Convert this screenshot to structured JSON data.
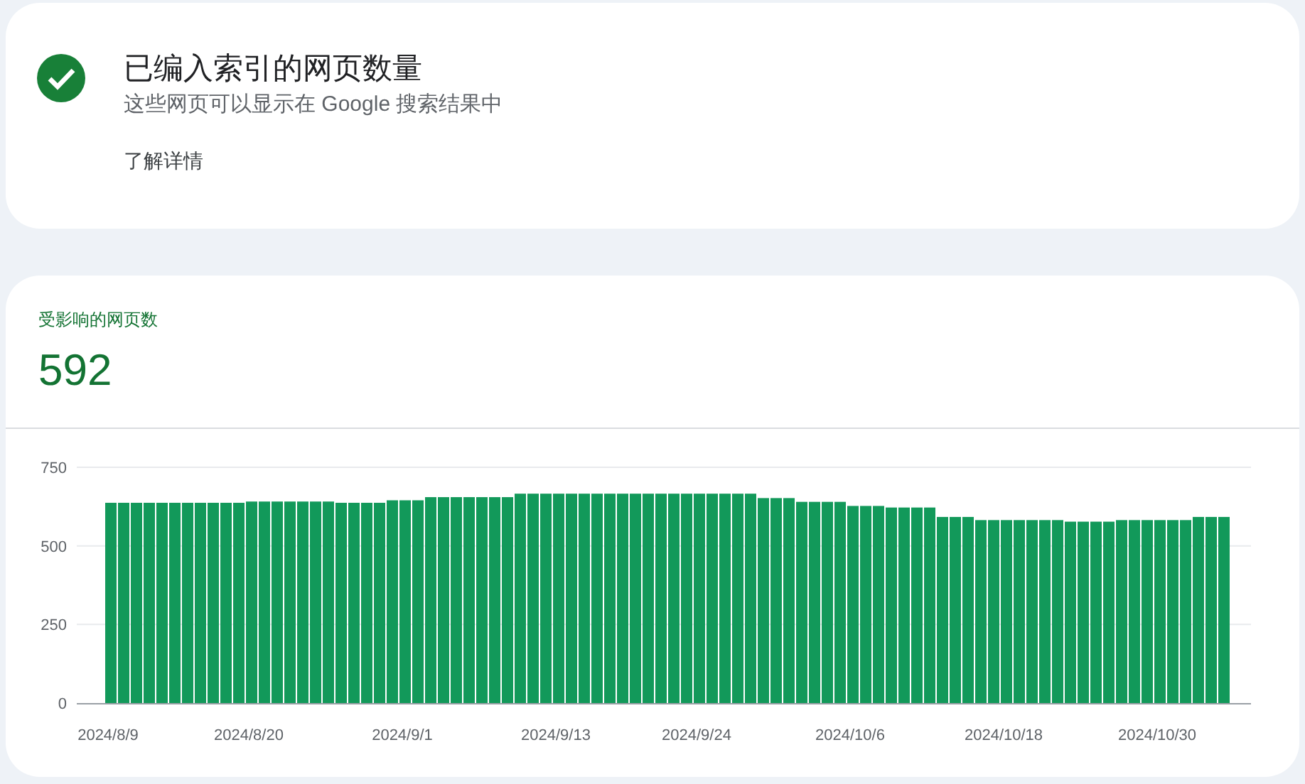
{
  "status_card": {
    "title": "已编入索引的网页数量",
    "subtitle": "这些网页可以显示在 Google 搜索结果中",
    "link": "了解详情"
  },
  "metric_card": {
    "label": "受影响的网页数",
    "value": "592",
    "chart_data": {
      "type": "bar",
      "ylim": [
        0,
        750
      ],
      "yticks": [
        0,
        250,
        500,
        750
      ],
      "categories": [
        "2024/8/9",
        null,
        null,
        null,
        null,
        null,
        null,
        null,
        null,
        null,
        null,
        "2024/8/20",
        null,
        null,
        null,
        null,
        null,
        null,
        null,
        null,
        null,
        null,
        null,
        "2024/9/1",
        null,
        null,
        null,
        null,
        null,
        null,
        null,
        null,
        null,
        null,
        null,
        "2024/9/13",
        null,
        null,
        null,
        null,
        null,
        null,
        null,
        null,
        null,
        null,
        "2024/9/24",
        null,
        null,
        null,
        null,
        null,
        null,
        null,
        null,
        null,
        null,
        null,
        "2024/10/6",
        null,
        null,
        null,
        null,
        null,
        null,
        null,
        null,
        null,
        null,
        null,
        "2024/10/18",
        null,
        null,
        null,
        null,
        null,
        null,
        null,
        null,
        null,
        null,
        null,
        "2024/10/30",
        null,
        null,
        null,
        null,
        null
      ],
      "values": [
        637,
        637,
        637,
        637,
        637,
        637,
        637,
        637,
        637,
        637,
        637,
        641,
        641,
        641,
        641,
        641,
        641,
        641,
        637,
        637,
        637,
        637,
        645,
        645,
        645,
        655,
        655,
        655,
        655,
        655,
        655,
        655,
        666,
        666,
        666,
        666,
        666,
        666,
        666,
        666,
        666,
        666,
        666,
        666,
        666,
        666,
        666,
        666,
        666,
        666,
        666,
        652,
        652,
        652,
        640,
        640,
        640,
        640,
        627,
        627,
        627,
        622,
        622,
        622,
        622,
        592,
        592,
        592,
        582,
        582,
        582,
        582,
        582,
        582,
        582,
        577,
        577,
        577,
        577,
        582,
        582,
        582,
        582,
        582,
        582,
        592,
        592,
        592
      ]
    }
  }
}
